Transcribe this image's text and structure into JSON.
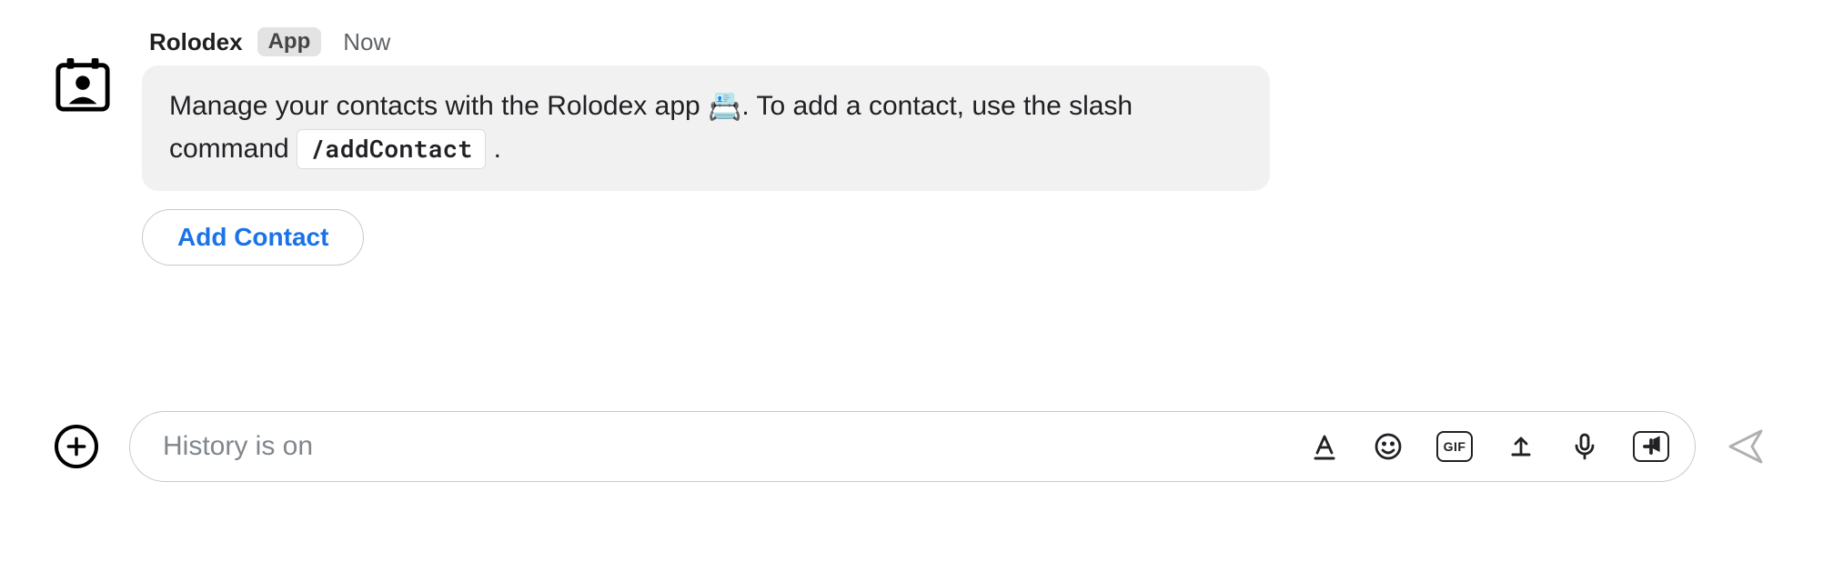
{
  "message": {
    "sender_name": "Rolodex",
    "app_badge": "App",
    "timestamp": "Now",
    "body_part1": "Manage your contacts with the Rolodex app ",
    "body_emoji": "📇",
    "body_part2": ". To add a contact, use the slash command ",
    "slash_command": "/addContact",
    "body_part3": " .",
    "action_label": "Add Contact"
  },
  "compose": {
    "placeholder": "History is on",
    "gif_label": "GIF"
  },
  "icons": {
    "plus": "plus-icon",
    "format": "text-format-icon",
    "emoji": "emoji-icon",
    "gif": "gif-icon",
    "upload": "upload-icon",
    "mic": "mic-icon",
    "video": "video-create-icon",
    "send": "send-icon",
    "avatar": "contact-avatar-icon"
  }
}
